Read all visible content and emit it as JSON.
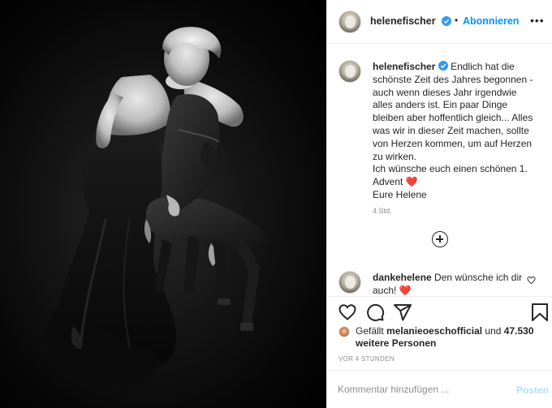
{
  "header": {
    "username": "helenefischer",
    "separator": "•",
    "follow_label": "Abonnieren",
    "more_glyph": "•••"
  },
  "caption": {
    "username": "helenefischer",
    "line1": "Endlich hat die schönste Zeit des Jahres begonnen - auch wenn dieses Jahr irgendwie alles anders ist. Ein paar Dinge bleiben aber hoffentlich gleich... Alles was wir in dieser Zeit machen, sollte von Herzen kommen, um auf Herzen zu wirken.",
    "line2": "Ich wünsche euch einen schönen 1. Advent",
    "line2_emoji": "❤️",
    "line3": "Eure Helene",
    "time": "4 Std."
  },
  "comment": {
    "username": "dankehelene",
    "text": "Den wünsche ich dir auch!",
    "emoji": "❤️"
  },
  "actions": {
    "like_icon": "heart-icon",
    "comment_icon": "comment-icon",
    "share_icon": "share-icon",
    "save_icon": "bookmark-icon"
  },
  "likes": {
    "prefix": "Gefällt",
    "user": "melanieoeschofficial",
    "middle": "und",
    "count": "47.530 weitere Personen"
  },
  "timestamp": "VOR 4 STUNDEN",
  "comment_box": {
    "placeholder": "Kommentar hinzufügen ...",
    "post_label": "Posten"
  },
  "colors": {
    "accent": "#0095f6",
    "verified": "#3897f0",
    "heart": "#ed4956",
    "post_disabled": "#b2dffc",
    "muted": "#8e8e8e"
  }
}
